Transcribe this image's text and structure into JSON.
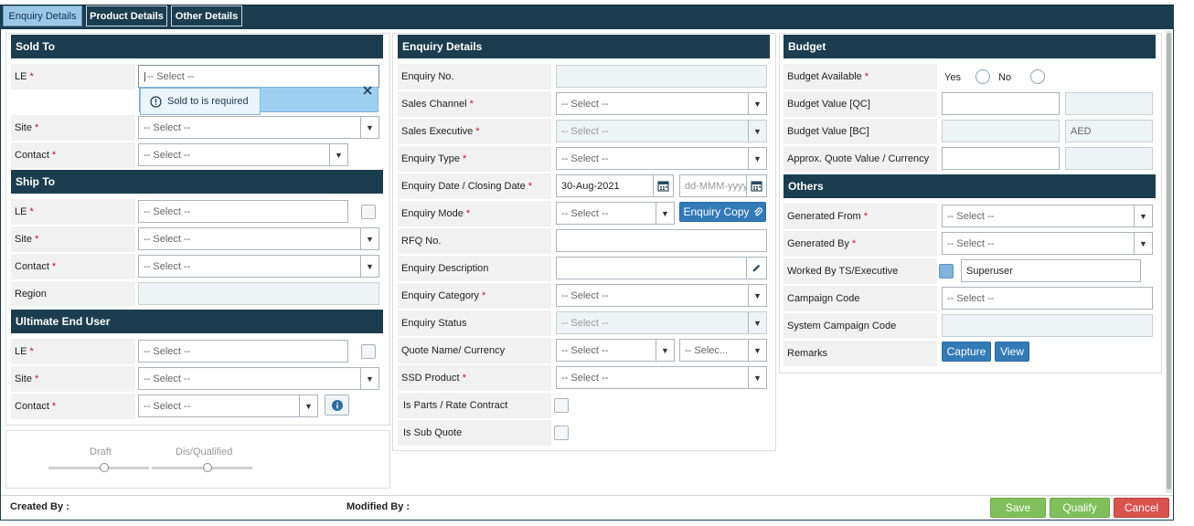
{
  "tabs": [
    {
      "label": "Enquiry Details"
    },
    {
      "label": "Product Details"
    },
    {
      "label": "Other Details"
    }
  ],
  "sold_to": {
    "title": "Sold To",
    "le_label": "LE",
    "le_placeholder": "-- Select --",
    "error_text": "Sold to is required",
    "site_label": "Site",
    "site_placeholder": "-- Select --",
    "contact_label": "Contact",
    "contact_placeholder": "-- Select --"
  },
  "ship_to": {
    "title": "Ship To",
    "le_label": "LE",
    "le_placeholder": "-- Select --",
    "site_label": "Site",
    "site_placeholder": "-- Select --",
    "contact_label": "Contact",
    "contact_placeholder": "-- Select --",
    "region_label": "Region"
  },
  "ultimate": {
    "title": "Ultimate End User",
    "le_label": "LE",
    "le_placeholder": "-- Select --",
    "site_label": "Site",
    "site_placeholder": "-- Select --",
    "contact_label": "Contact",
    "contact_placeholder": "-- Select --"
  },
  "status_track": {
    "draft": "Draft",
    "qualified": "Dis/Qualified"
  },
  "enquiry": {
    "title": "Enquiry Details",
    "enquiry_no_label": "Enquiry No.",
    "sales_channel_label": "Sales Channel",
    "sales_channel_value": "-- Select --",
    "sales_exec_label": "Sales Executive",
    "sales_exec_value": "-- Select --",
    "type_label": "Enquiry Type",
    "type_value": "-- Select --",
    "date_label": "Enquiry Date / Closing Date",
    "enquiry_date": "30-Aug-2021",
    "closing_date_placeholder": "dd-MMM-yyyy",
    "mode_label": "Enquiry Mode",
    "mode_value": "-- Select --",
    "copy_button": "Enquiry Copy",
    "rfq_label": "RFQ No.",
    "description_label": "Enquiry Description",
    "category_label": "Enquiry Category",
    "category_value": "-- Select --",
    "status_label": "Enquiry Status",
    "status_value": "-- Select --",
    "quote_label": "Quote Name/ Currency",
    "quote_value": "-- Select --",
    "currency_value": "-- Selec...",
    "ssd_label": "SSD Product",
    "ssd_value": "-- Select --",
    "parts_label": "Is Parts / Rate Contract",
    "subquote_label": "Is Sub Quote"
  },
  "budget": {
    "title": "Budget",
    "available_label": "Budget Available",
    "yes_label": "Yes",
    "no_label": "No",
    "value_qc_label": "Budget Value [QC]",
    "value_bc_label": "Budget Value [BC]",
    "bc_currency": "AED",
    "approx_label": "Approx. Quote Value / Currency"
  },
  "others": {
    "title": "Others",
    "generated_from_label": "Generated From",
    "generated_from_value": "-- Select --",
    "generated_by_label": "Generated By",
    "generated_by_value": "-- Select --",
    "worked_by_label": "Worked By TS/Executive",
    "worked_by_value": "Superuser",
    "campaign_label": "Campaign Code",
    "campaign_value": "-- Select --",
    "system_campaign_label": "System Campaign Code",
    "remarks_label": "Remarks",
    "capture_button": "Capture",
    "view_button": "View"
  },
  "footer": {
    "created_by": "Created By :",
    "modified_by": "Modified By :",
    "save": "Save",
    "qualify": "Qualify",
    "cancel": "Cancel"
  },
  "colors": {
    "header": "#1b3d4f",
    "accent": "#337ab7",
    "required": "#c0162c"
  }
}
